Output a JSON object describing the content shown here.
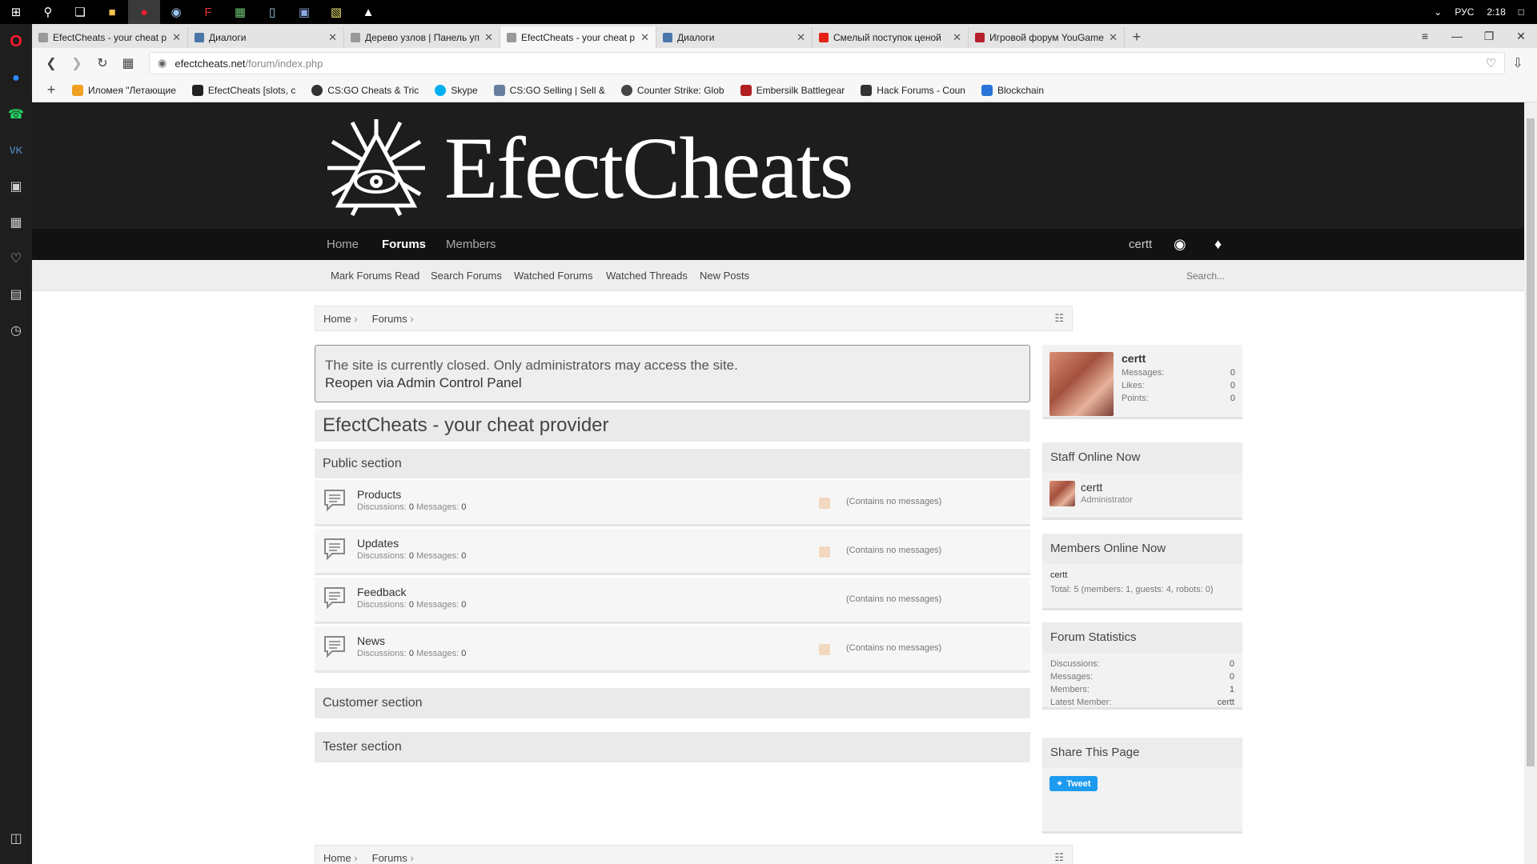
{
  "taskbar": {
    "lang": "РУС",
    "time": "2:18"
  },
  "tabs": [
    {
      "label": "EfectCheats - your cheat p",
      "color": "#888",
      "active": false
    },
    {
      "label": "Диалоги",
      "color": "#4a76a8",
      "active": false
    },
    {
      "label": "Дерево узлов | Панель уп",
      "color": "#888",
      "active": false
    },
    {
      "label": "EfectCheats - your cheat p",
      "color": "#888",
      "active": true
    },
    {
      "label": "Диалоги",
      "color": "#4a76a8",
      "active": false
    },
    {
      "label": "Смелый поступок ценой",
      "color": "#e62117",
      "active": false
    },
    {
      "label": "Игровой форум YouGame",
      "color": "#b5212d",
      "active": false
    }
  ],
  "address": {
    "domain": "efectcheats.net",
    "path": "/forum/index.php"
  },
  "bookmarks": [
    {
      "label": "Иломея \"Летающие",
      "color": "#f0a020"
    },
    {
      "label": "EfectCheats [slots, c",
      "color": "#222"
    },
    {
      "label": "CS:GO Cheats & Tric",
      "color": "#333"
    },
    {
      "label": "Skype",
      "color": "#00aff0"
    },
    {
      "label": "CS:GO Selling | Sell &",
      "color": "#6a7fa0"
    },
    {
      "label": "Counter Strike: Glob",
      "color": "#444"
    },
    {
      "label": "Embersilk Battlegear",
      "color": "#b02020"
    },
    {
      "label": "Hack Forums - Coun",
      "color": "#333"
    },
    {
      "label": "Blockchain",
      "color": "#2874d8"
    }
  ],
  "site": {
    "logo_text": "EfectCheats",
    "nav": {
      "home": "Home",
      "forums": "Forums",
      "members": "Members",
      "user": "certt"
    },
    "subnav": {
      "mark_read": "Mark Forums Read",
      "search_forums": "Search Forums",
      "watched_forums": "Watched Forums",
      "watched_threads": "Watched Threads",
      "new_posts": "New Posts",
      "search_placeholder": "Search..."
    },
    "breadcrumb": {
      "home": "Home",
      "forums": "Forums"
    },
    "notice": {
      "line1": "The site is currently closed. Only administrators may access the site.",
      "link": "Reopen via Admin Control Panel"
    },
    "board_title": "EfectCheats - your cheat provider",
    "public_section": "Public section",
    "forums": [
      {
        "title": "Products",
        "discussions": "0",
        "messages": "0",
        "rss": true,
        "status": "(Contains no messages)"
      },
      {
        "title": "Updates",
        "discussions": "0",
        "messages": "0",
        "rss": true,
        "status": "(Contains no messages)"
      },
      {
        "title": "Feedback",
        "discussions": "0",
        "messages": "0",
        "rss": false,
        "status": "(Contains no messages)"
      },
      {
        "title": "News",
        "discussions": "0",
        "messages": "0",
        "rss": true,
        "status": "(Contains no messages)"
      }
    ],
    "labels": {
      "discussions": "Discussions:",
      "messages": "Messages:"
    },
    "customer_section": "Customer section",
    "tester_section": "Tester section"
  },
  "sidebar": {
    "profile": {
      "name": "certt",
      "messages_label": "Messages:",
      "messages": "0",
      "likes_label": "Likes:",
      "likes": "0",
      "points_label": "Points:",
      "points": "0"
    },
    "staff": {
      "title": "Staff Online Now",
      "name": "certt",
      "role": "Administrator"
    },
    "members": {
      "title": "Members Online Now",
      "name": "certt",
      "total": "Total: 5 (members: 1, guests: 4, robots: 0)"
    },
    "stats": {
      "title": "Forum Statistics",
      "disc_label": "Discussions:",
      "disc": "0",
      "msg_label": "Messages:",
      "msg": "0",
      "mem_label": "Members:",
      "mem": "1",
      "latest_label": "Latest Member:",
      "latest": "certt"
    },
    "share": {
      "title": "Share This Page",
      "tweet": "Tweet"
    }
  }
}
